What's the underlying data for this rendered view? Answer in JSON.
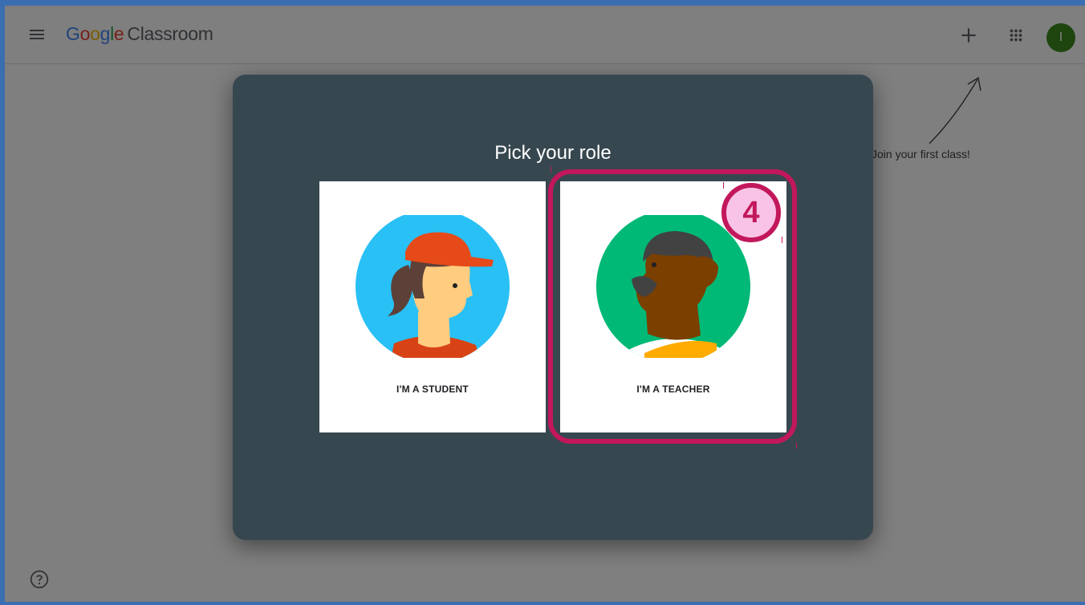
{
  "header": {
    "logo": {
      "g1": "G",
      "g2": "o",
      "g3": "o",
      "g4": "g",
      "g5": "l",
      "g6": "e",
      "product": "Classroom"
    },
    "avatar_initial": "I"
  },
  "page": {
    "join_hint": "Join your first class!"
  },
  "dialog": {
    "title": "Pick your role",
    "student_label": "I'M A STUDENT",
    "teacher_label": "I'M A TEACHER"
  },
  "annotation": {
    "step_number": "4"
  },
  "icons": [
    "menu-icon",
    "plus-icon",
    "apps-grid-icon",
    "help-icon"
  ],
  "colors": {
    "dialog_bg": "#37474f",
    "highlight": "#c2185b",
    "badge_fill": "#f8c3e6",
    "avatar_bg": "#3f8a1f",
    "student_circle": "#29c0f5",
    "teacher_circle": "#00b976"
  }
}
